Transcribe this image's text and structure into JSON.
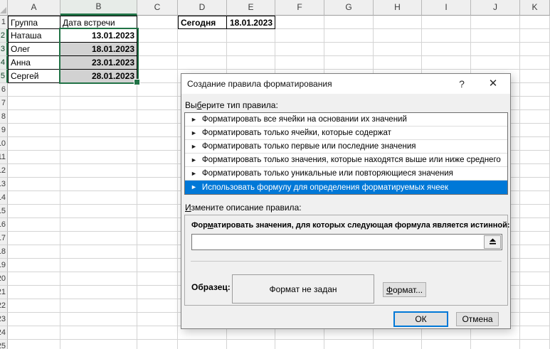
{
  "colors": {
    "excel_green": "#217346",
    "selection_fill": "#d2d2d2",
    "selected_rule_bg": "#0078d7",
    "dialog_bg": "#f0f0f0"
  },
  "spreadsheet": {
    "column_headers": [
      "A",
      "B",
      "C",
      "D",
      "E",
      "F",
      "G",
      "H",
      "I",
      "J",
      "K"
    ],
    "visible_rows": 25,
    "selected_column": "B",
    "selected_rows": [
      2,
      3,
      4,
      5
    ],
    "active_cell": "B2",
    "table": {
      "headers": [
        "Группа",
        "Дата встречи"
      ],
      "rows": [
        {
          "name": "Наташа",
          "date": "13.01.2023"
        },
        {
          "name": "Олег",
          "date": "18.01.2023"
        },
        {
          "name": "Анна",
          "date": "23.01.2023"
        },
        {
          "name": "Сергей",
          "date": "28.01.2023"
        }
      ]
    },
    "today": {
      "label": "Сегодня",
      "value": "18.01.2023"
    }
  },
  "dialog": {
    "title": "Создание правила форматирования",
    "help_button": "?",
    "close_button": "✕",
    "rule_type_label": {
      "pre": "Вы",
      "key": "б",
      "post": "ерите тип правила:"
    },
    "rule_marker": "►",
    "rule_types": [
      "Форматировать все ячейки на основании их значений",
      "Форматировать только ячейки, которые содержат",
      "Форматировать только первые или последние значения",
      "Форматировать только значения, которые находятся выше или ниже среднего",
      "Форматировать только уникальные или повторяющиеся значения",
      "Использовать формулу для определения форматируемых ячеек"
    ],
    "selected_rule_index": 5,
    "edit_description_label": {
      "pre": "",
      "key": "И",
      "post": "змените описание правила:"
    },
    "formula_label": {
      "pre": "Фор",
      "key": "м",
      "post": "атировать значения, для которых следующая формула является истинной:"
    },
    "formula_value": "",
    "sample_label": "Образец:",
    "sample_text": "Формат не задан",
    "format_button": {
      "pre": "",
      "key": "Ф",
      "post": "ормат..."
    },
    "ok_button": "ОК",
    "cancel_button": "Отмена"
  }
}
